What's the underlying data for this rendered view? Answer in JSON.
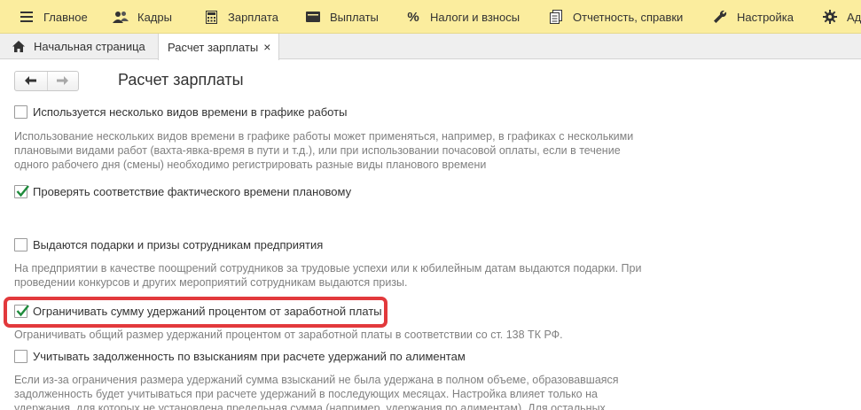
{
  "top_menu": {
    "items": [
      {
        "label": "Главное",
        "icon": "hamburger-icon"
      },
      {
        "label": "Кадры",
        "icon": "people-icon"
      },
      {
        "label": "Зарплата",
        "icon": "calculator-icon"
      },
      {
        "label": "Выплаты",
        "icon": "wallet-icon"
      },
      {
        "label": "Налоги и взносы",
        "icon": "percent-icon"
      },
      {
        "label": "Отчетность, справки",
        "icon": "documents-icon"
      },
      {
        "label": "Настройка",
        "icon": "wrench-icon"
      },
      {
        "label": "Ад",
        "icon": "gear-icon"
      }
    ]
  },
  "tabs": {
    "home_label": "Начальная страница",
    "active_label": "Расчет зарплаты",
    "close_glyph": "×"
  },
  "page": {
    "title": "Расчет зарплаты"
  },
  "settings": [
    {
      "label": "Используется несколько видов времени в графике работы",
      "checked": false
    },
    {
      "label": "Проверять соответствие фактического времени плановому",
      "checked": true
    },
    {
      "label": "Выдаются подарки и призы сотрудникам предприятия",
      "checked": false
    },
    {
      "label": "Ограничивать сумму удержаний процентом от заработной платы",
      "checked": true,
      "highlighted": true
    },
    {
      "label": "Учитывать задолженность по взысканиям при расчете удержаний по алиментам",
      "checked": false
    }
  ],
  "hints": {
    "multi_time": [
      "Использование нескольких видов времени в графике работы может применяться, например, в графиках с несколькими",
      "плановыми видами работ (вахта-явка-время в пути и т.д.), или при использовании почасовой оплаты, если в течение",
      "одного рабочего дня (смены) необходимо регистрировать разные виды планового времени"
    ],
    "gifts": [
      "На предприятии в качестве поощрений сотрудников за трудовые успехи или к юбилейным датам выдаются подарки. При",
      "проведении конкурсов и других мероприятий сотрудникам выдаются призы."
    ],
    "limit": [
      "Ограничивать общий размер удержаний процентом от заработной платы в соответствии со ст. 138 ТК РФ."
    ],
    "alimony": [
      "Если из-за ограничения размера удержаний сумма взысканий не была удержана в полном объеме, образовавшаяся",
      "задолженность будет учитываться при расчете удержаний в последующих месяцах. Настройка влияет только на",
      "удержания, для которых не установлена предельная сумма (например, удержания по алиментам). Для остальных"
    ]
  },
  "colors": {
    "menu_bg": "#fbed9e",
    "highlight": "#e2393c",
    "check": "#1e8b3c"
  }
}
